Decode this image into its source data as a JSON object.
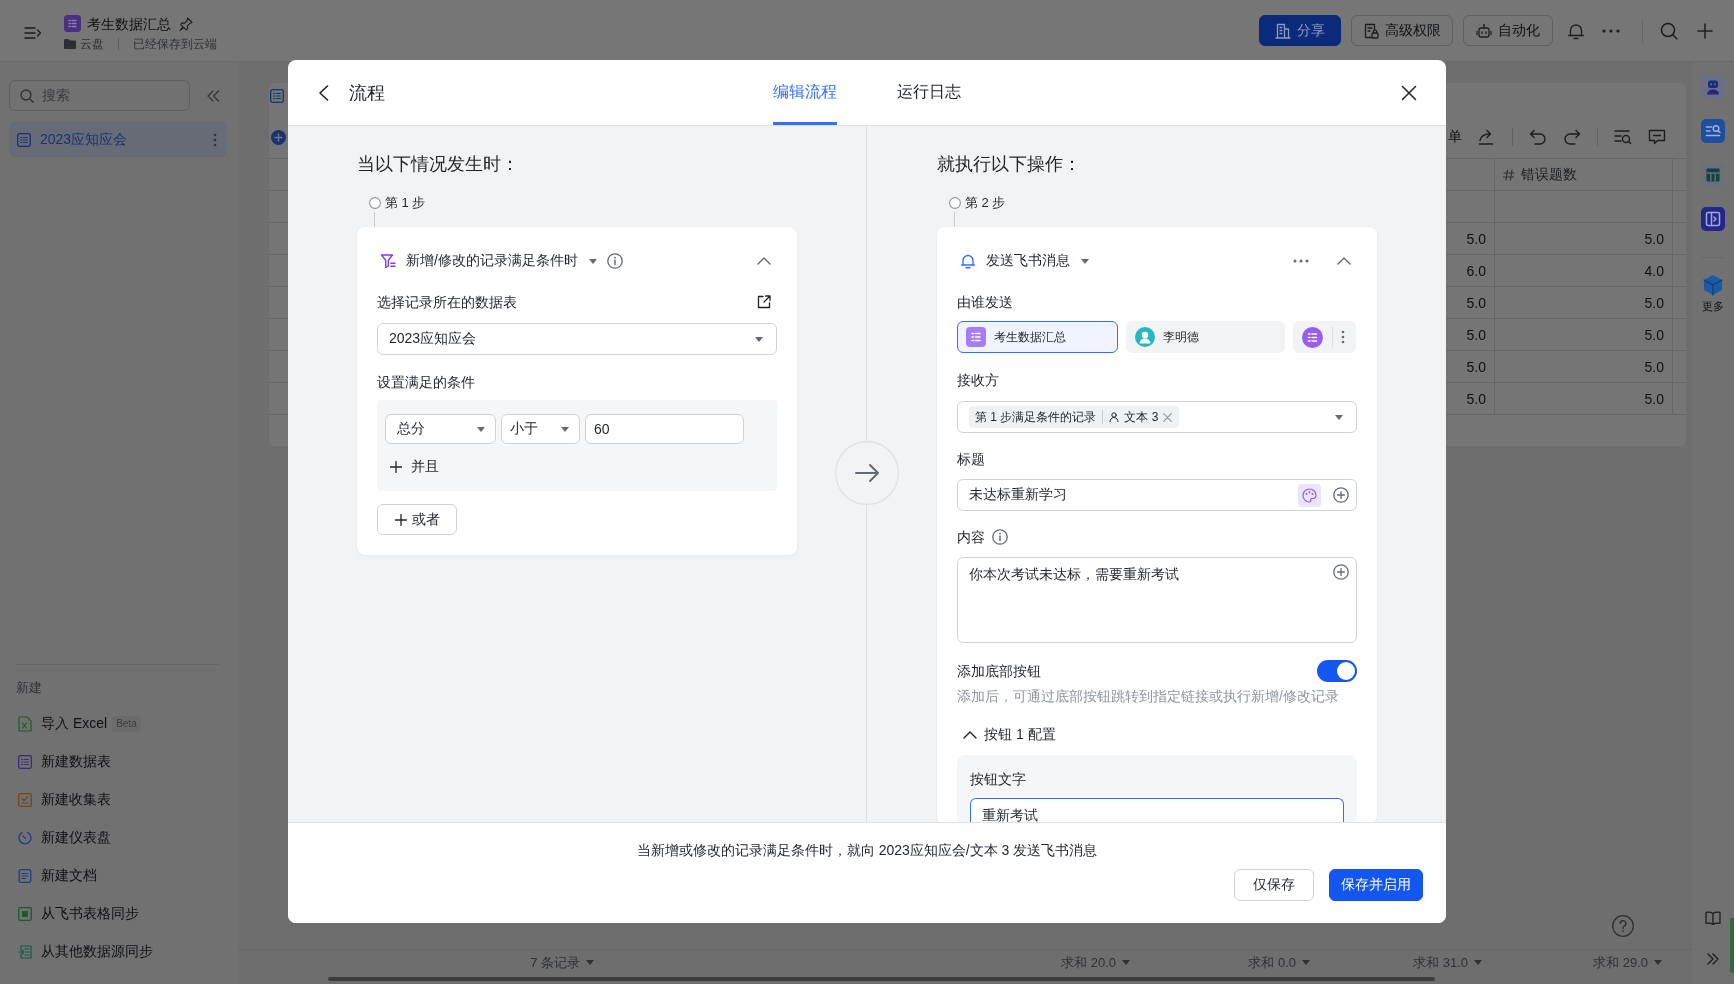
{
  "app_bar": {
    "title": "考生数据汇总",
    "location": "云盘",
    "save_status": "已经保存到云端",
    "buttons": [
      {
        "label": "分享",
        "kind": "primary"
      },
      {
        "label": "高级权限",
        "kind": "permissions"
      },
      {
        "label": "自动化",
        "kind": "automation"
      }
    ]
  },
  "sidebar": {
    "search": {
      "placeholder": "搜索"
    },
    "tables": [
      {
        "label": "2023应知应会",
        "selected": true
      }
    ],
    "create": {
      "title": "新建",
      "items": [
        {
          "label": "导入 Excel",
          "badge": "Beta",
          "kind": "excel"
        },
        {
          "label": "新建数据表",
          "kind": "table"
        },
        {
          "label": "新建收集表",
          "kind": "form"
        },
        {
          "label": "新建仪表盘",
          "kind": "dashboard"
        },
        {
          "label": "新建文档",
          "kind": "doc"
        },
        {
          "label": "从飞书表格同步",
          "kind": "sheet"
        },
        {
          "label": "从其他数据源同步",
          "kind": "source"
        }
      ]
    }
  },
  "table": {
    "toolbar_text": "单",
    "header": {
      "column_2": "错误题数"
    },
    "rows": [
      {
        "column_1": "5.0",
        "column_2": "5.0"
      },
      {
        "column_1": "6.0",
        "column_2": "4.0"
      },
      {
        "column_1": "5.0",
        "column_2": "5.0"
      },
      {
        "column_1": "5.0",
        "column_2": "5.0"
      },
      {
        "column_1": "5.0",
        "column_2": "5.0"
      },
      {
        "column_1": "5.0",
        "column_2": "5.0"
      }
    ]
  },
  "status_bar": {
    "record_count": "7 条记录",
    "sums": [
      "求和 20.0",
      "求和 0.0",
      "求和 31.0",
      "求和 29.0"
    ]
  },
  "right_rail": {
    "more_label": "更多"
  },
  "dialog": {
    "title": "流程",
    "tabs": [
      {
        "label": "编辑流程",
        "selected": true
      },
      {
        "label": "运行日志",
        "selected": false
      }
    ],
    "trigger": {
      "heading": "当以下情况发生时：",
      "step": "第 1 步",
      "type": "新增/修改的记录满足条件时",
      "expanded": true,
      "table_label": "选择记录所在的数据表",
      "table": "2023应知应会",
      "conditions_label": "设置满足的条件",
      "conditions": [
        {
          "field": "总分",
          "operator": "小于",
          "value": "60"
        }
      ],
      "and_label": "并且",
      "or_label": "或者"
    },
    "action": {
      "heading": "就执行以下操作：",
      "step": "第 2 步",
      "type": "发送飞书消息",
      "expanded": true,
      "sender_label": "由谁发送",
      "senders": [
        {
          "label": "考生数据汇总",
          "kind": "app",
          "selected": true
        },
        {
          "label": "李明德",
          "kind": "person",
          "selected": false
        },
        {
          "kind": "bot",
          "selected": false
        }
      ],
      "recipient_label": "接收方",
      "recipients": [
        {
          "source": "第 1 步满足条件的记录",
          "field": "文本 3"
        }
      ],
      "title_label": "标题",
      "title": "未达标重新学习",
      "content_label": "内容",
      "content": "你本次考试未达标，需要重新考试",
      "bottom_button": {
        "label": "添加底部按钮",
        "on": true,
        "hint": "添加后，可通过底部按钮跳转到指定链接或执行新增/修改记录",
        "config_title": "按钮 1 配置",
        "expanded": true,
        "text_label": "按钮文字",
        "text": "重新考试"
      }
    },
    "summary": "当新增或修改的记录满足条件时，就向 2023应知应会/文本 3 发送飞书消息",
    "buttons": [
      {
        "label": "仅保存",
        "kind": "secondary"
      },
      {
        "label": "保存并启用",
        "kind": "primary"
      }
    ]
  }
}
